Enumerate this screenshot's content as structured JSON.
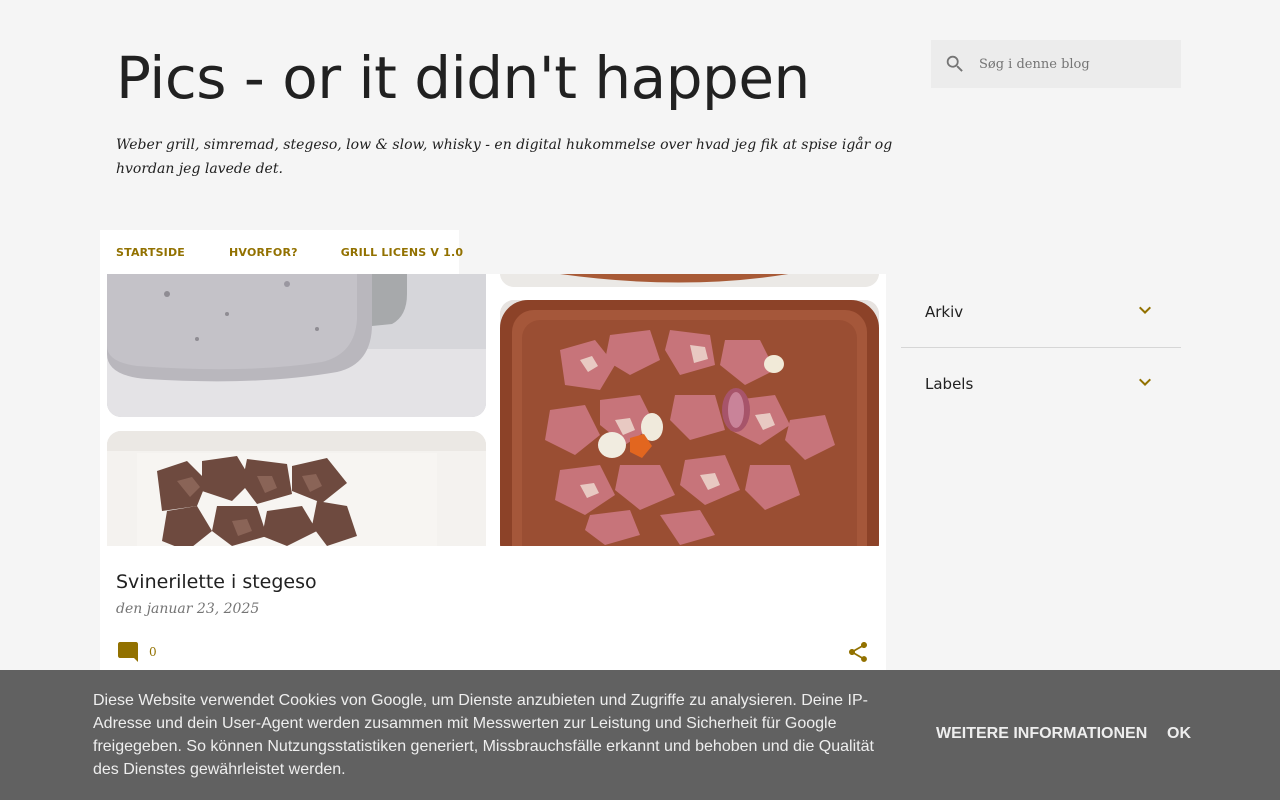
{
  "blog": {
    "title": "Pics - or it didn't happen",
    "description": "Weber grill, simremad, stegeso, low & slow, whisky - en digital hukommelse over hvad jeg fik at spise igår og hvordan jeg lavede det."
  },
  "search": {
    "placeholder": "Søg i denne blog",
    "icon": "search-icon"
  },
  "nav": {
    "tabs": [
      {
        "label": "STARTSIDE"
      },
      {
        "label": "HVORFOR?"
      },
      {
        "label": "GRILL LICENS V 1.0"
      }
    ]
  },
  "post": {
    "title": "Svinerilette i stegeso",
    "date": "den januar 23, 2025",
    "comment_count": "0",
    "accent_color": "#927100"
  },
  "sidebar": {
    "widgets": [
      {
        "title": "Arkiv",
        "icon": "chevron-down-icon"
      },
      {
        "title": "Labels",
        "icon": "chevron-down-icon"
      }
    ]
  },
  "cookie_bar": {
    "text": "Diese Website verwendet Cookies von Google, um Dienste anzubieten und Zugriffe zu analysieren. Deine IP-Adresse und dein User-Agent werden zusammen mit Messwerten zur Leistung und Sicherheit für Google freigegeben. So können Nutzungsstatistiken generiert, Missbrauchsfälle erkannt und behoben und die Qualität des Dienstes gewährleistet werden.",
    "more_label": "Weitere Informationen",
    "ok_label": "OK"
  }
}
